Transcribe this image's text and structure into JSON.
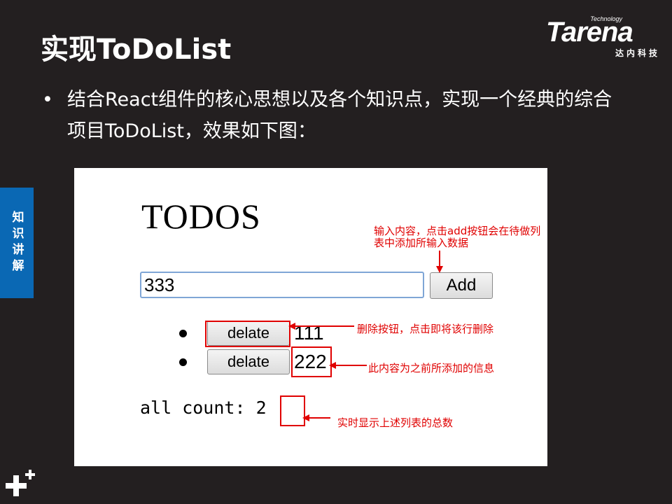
{
  "slide": {
    "title": "实现ToDoList",
    "bullet": "结合React组件的核心思想以及各个知识点，实现一个经典的综合项目ToDoList，效果如下图：",
    "bullet_mark": "•",
    "side_tab": "知识讲解",
    "logo": {
      "tech": "Technology",
      "main": "Tarena",
      "sub": "达内科技"
    }
  },
  "app": {
    "title": "TODOS",
    "input_value": "333",
    "add_label": "Add",
    "items": [
      {
        "delete_label": "delate",
        "text": "111"
      },
      {
        "delete_label": "delate",
        "text": "222"
      }
    ],
    "count_label": "all count:",
    "count_value": "2"
  },
  "annotations": {
    "input_note": "输入内容，点击add按钮会在待做列表中添加所输入数据",
    "delete_note": "删除按钮，点击即将该行删除",
    "item_note": "此内容为之前所添加的信息",
    "count_note": "实时显示上述列表的总数"
  },
  "colors": {
    "background": "#231f20",
    "side_tab": "#0a68b4",
    "annotation_red": "#e00000"
  }
}
